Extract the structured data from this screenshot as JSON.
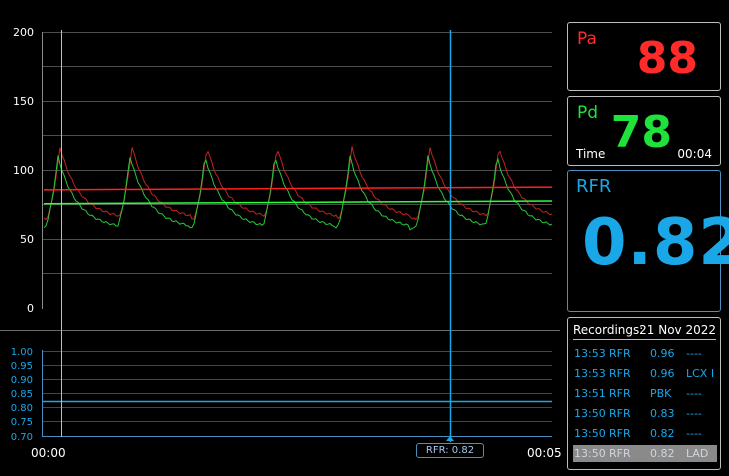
{
  "pressure_plot": {
    "y_ticks": [
      "200",
      "150",
      "100",
      "50",
      "0"
    ]
  },
  "rfr_plot": {
    "y_ticks": [
      "1.00",
      "0.95",
      "0.90",
      "0.85",
      "0.80",
      "0.75",
      "0.70"
    ]
  },
  "time_axis": {
    "start": "00:00",
    "end": "00:05"
  },
  "cursor": {
    "label": "RFR: 0.82"
  },
  "pa": {
    "label": "Pa",
    "value": "88",
    "color": "#ff2b2b"
  },
  "pd": {
    "label": "Pd",
    "value": "78",
    "color": "#1fe23a",
    "time_label": "Time",
    "time_value": "00:04"
  },
  "rfr": {
    "label": "RFR",
    "value": "0.82",
    "color": "#1aa7e8"
  },
  "recordings": {
    "title": "Recordings:",
    "date": "21 Nov 2022",
    "rows": [
      {
        "time": "13:53",
        "type": "RFR",
        "value": "0.96",
        "vessel": "----"
      },
      {
        "time": "13:53",
        "type": "RFR",
        "value": "0.96",
        "vessel": "LCX I"
      },
      {
        "time": "13:51",
        "type": "RFR",
        "value": "PBK",
        "vessel": "----"
      },
      {
        "time": "13:50",
        "type": "RFR",
        "value": "0.83",
        "vessel": "----"
      },
      {
        "time": "13:50",
        "type": "RFR",
        "value": "0.82",
        "vessel": "----"
      },
      {
        "time": "13:50",
        "type": "RFR",
        "value": "0.82",
        "vessel": "LAD"
      }
    ]
  }
}
